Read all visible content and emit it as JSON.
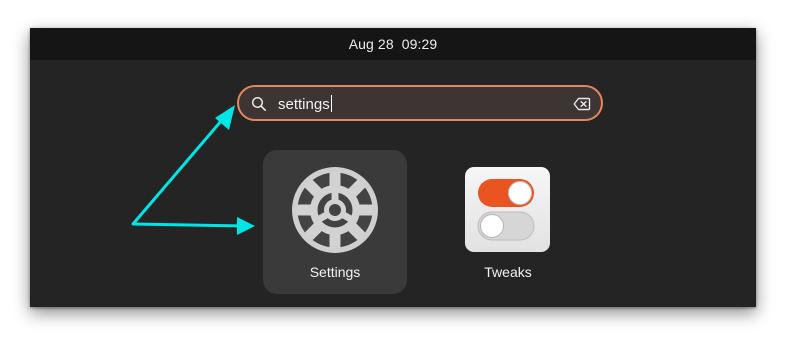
{
  "topbar": {
    "date": "Aug 28",
    "time": "09:29"
  },
  "search": {
    "query": "settings",
    "icon": "search-icon",
    "clear_icon": "backspace-clear-icon"
  },
  "apps": [
    {
      "label": "Settings",
      "icon": "settings-gear-icon",
      "selected": true
    },
    {
      "label": "Tweaks",
      "icon": "tweaks-toggle-icon",
      "selected": false
    }
  ],
  "colors": {
    "accent": "#e95420",
    "search_border": "#e4875c",
    "annotation_arrow": "#00e5e5",
    "background": "#242424",
    "topbar": "#151515"
  }
}
